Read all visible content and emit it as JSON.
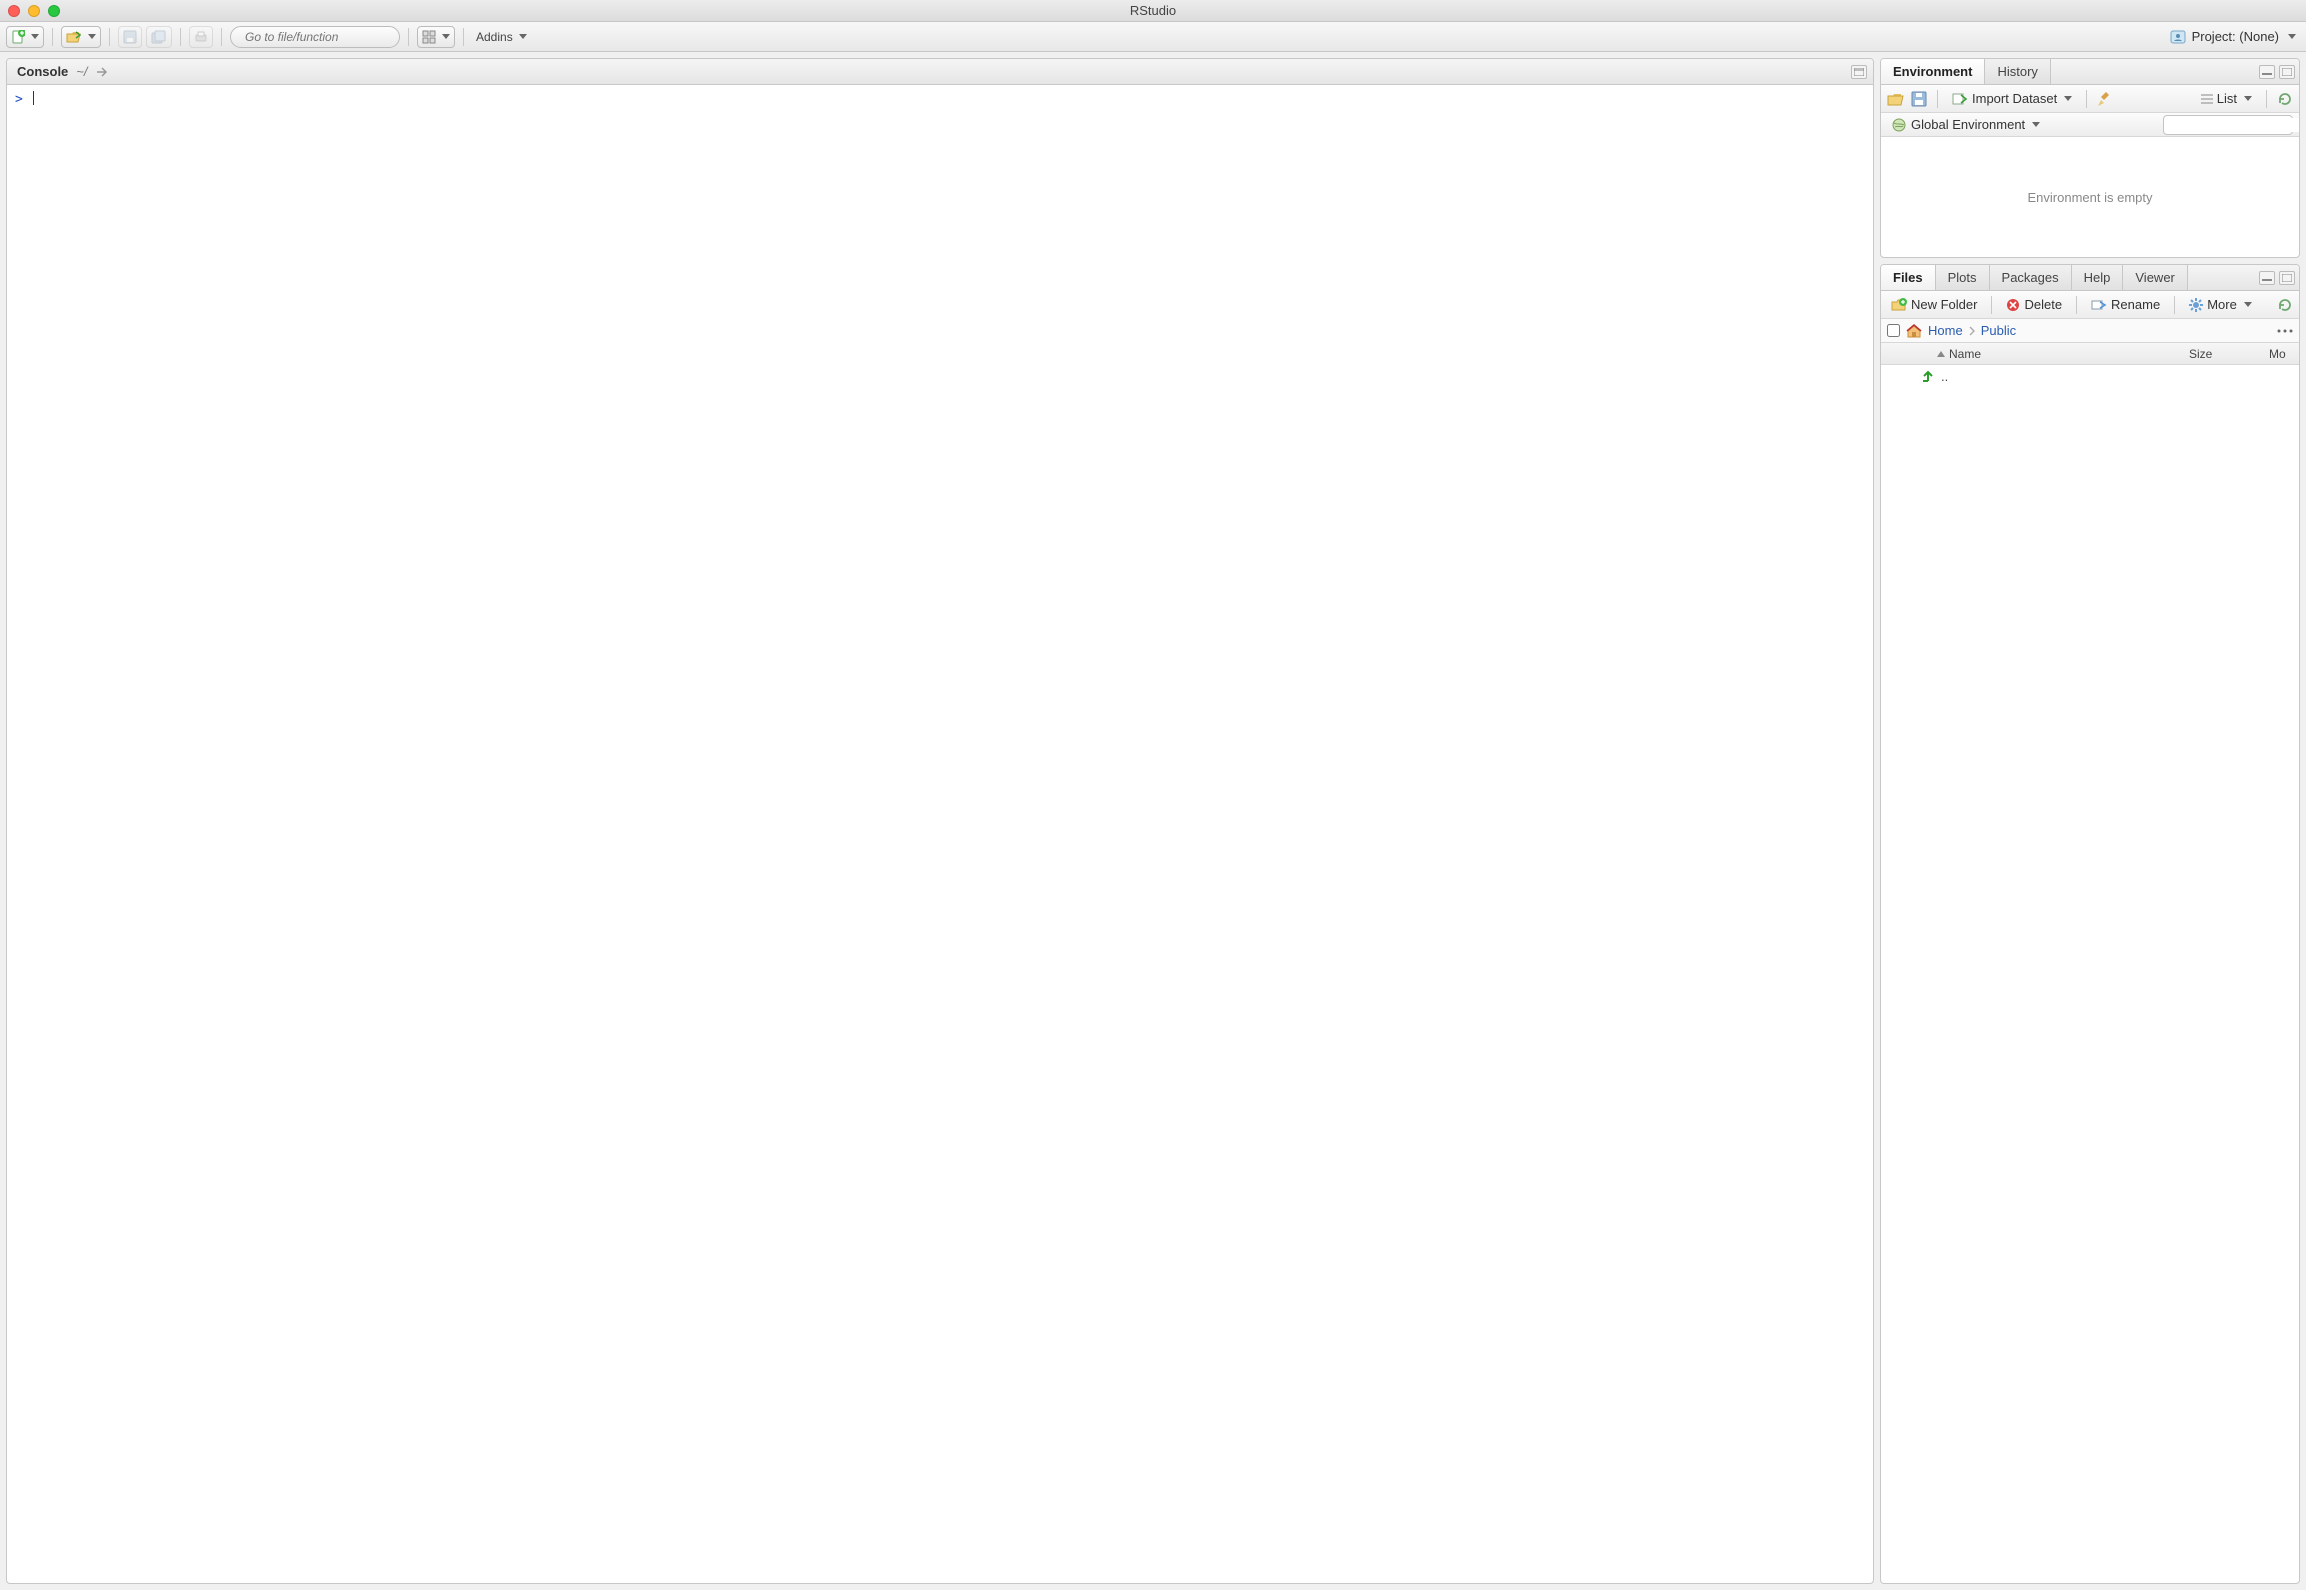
{
  "window": {
    "title": "RStudio"
  },
  "maintoolbar": {
    "goto_placeholder": "Go to file/function",
    "addins_label": "Addins"
  },
  "project": {
    "label": "Project: (None)"
  },
  "console": {
    "title": "Console",
    "path": "~/",
    "prompt": ">"
  },
  "env_tabs": {
    "environment": "Environment",
    "history": "History"
  },
  "env_toolbar": {
    "import_label": "Import Dataset",
    "list_label": "List"
  },
  "env_scope": {
    "label": "Global Environment"
  },
  "env_empty": "Environment is empty",
  "files_tabs": {
    "files": "Files",
    "plots": "Plots",
    "packages": "Packages",
    "help": "Help",
    "viewer": "Viewer"
  },
  "files_toolbar": {
    "new_folder": "New Folder",
    "delete": "Delete",
    "rename": "Rename",
    "more": "More"
  },
  "breadcrumbs": {
    "home": "Home",
    "public": "Public"
  },
  "files_columns": {
    "name": "Name",
    "size": "Size",
    "modified": "Mo"
  },
  "files_rows": {
    "parent": ".."
  }
}
